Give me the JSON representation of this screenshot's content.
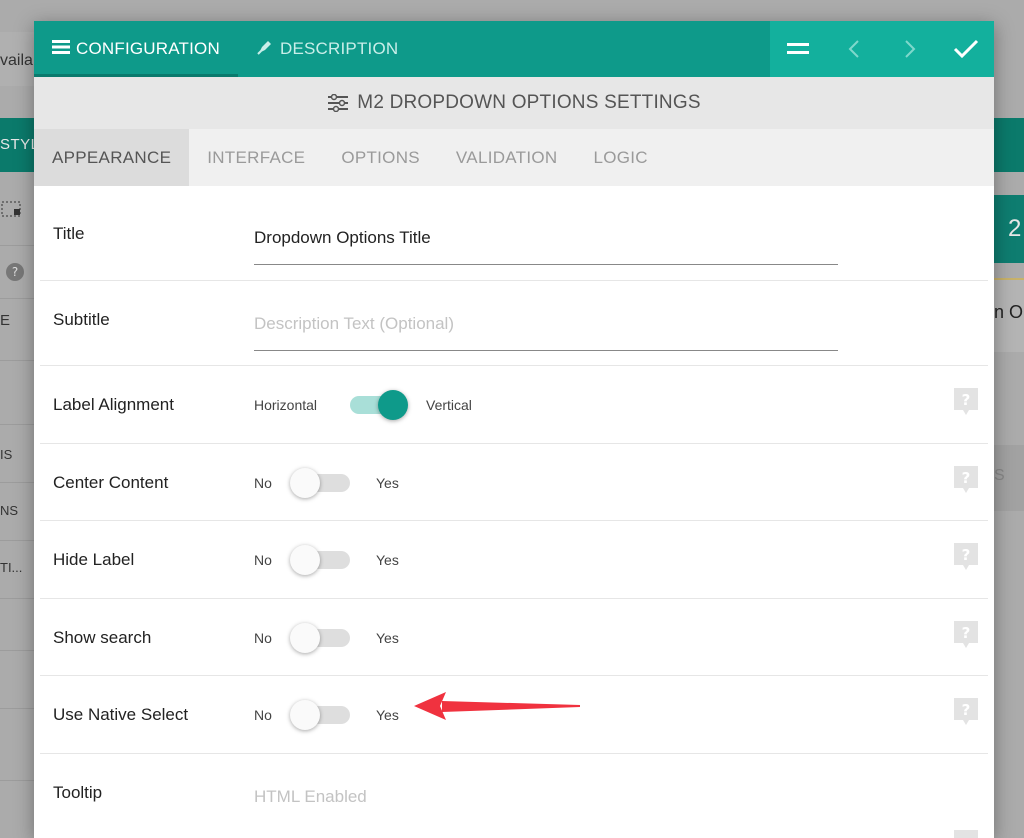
{
  "background": {
    "left_top_fragment": "vaila",
    "left_style_fragment": "STYL",
    "left_rows": [
      "IS",
      "NS",
      "TI..."
    ],
    "left_e": "E",
    "right_number": "2",
    "right_field_fragment": "n O",
    "right_gray_fragment": "S"
  },
  "dialog": {
    "top_tabs": [
      {
        "label": "CONFIGURATION",
        "icon": "list-icon"
      },
      {
        "label": "DESCRIPTION",
        "icon": "pen-icon"
      }
    ],
    "actions": [
      "menu-icon",
      "chevron-left-icon",
      "chevron-right-icon",
      "check-icon"
    ],
    "settings_title": "M2 DROPDOWN OPTIONS SETTINGS",
    "tabs": [
      "APPEARANCE",
      "INTERFACE",
      "OPTIONS",
      "VALIDATION",
      "LOGIC"
    ],
    "active_tab": "APPEARANCE",
    "fields": {
      "title": {
        "label": "Title",
        "value": "Dropdown Options Title"
      },
      "subtitle": {
        "label": "Subtitle",
        "placeholder": "Description Text (Optional)"
      },
      "label_alignment": {
        "label": "Label Alignment",
        "off": "Horizontal",
        "on": "Vertical",
        "state": "on"
      },
      "center_content": {
        "label": "Center Content",
        "off": "No",
        "on": "Yes",
        "state": "off"
      },
      "hide_label": {
        "label": "Hide Label",
        "off": "No",
        "on": "Yes",
        "state": "off"
      },
      "show_search": {
        "label": "Show search",
        "off": "No",
        "on": "Yes",
        "state": "off"
      },
      "use_native_select": {
        "label": "Use Native Select",
        "off": "No",
        "on": "Yes",
        "state": "off"
      },
      "tooltip": {
        "label": "Tooltip",
        "placeholder": "HTML Enabled"
      }
    }
  },
  "colors": {
    "primary": "#0e9a8a",
    "primary_light": "#13b09d",
    "annotation_arrow": "#f0323f"
  }
}
